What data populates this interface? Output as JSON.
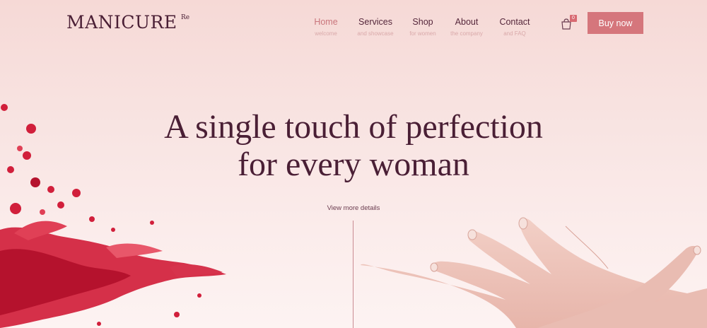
{
  "brand": {
    "name": "MANICURE",
    "superscript": "Re"
  },
  "nav": [
    {
      "label": "Home",
      "sub": "welcome"
    },
    {
      "label": "Services",
      "sub": "and showcase"
    },
    {
      "label": "Shop",
      "sub": "for women"
    },
    {
      "label": "About",
      "sub": "the company"
    },
    {
      "label": "Contact",
      "sub": "and FAQ"
    }
  ],
  "nav_active": "Home",
  "cart": {
    "icon": "shopping-bag-icon",
    "count": "0"
  },
  "buy_button": "Buy now",
  "hero": {
    "line1": "A single touch of perfection",
    "line2": "for every woman",
    "link": "View more details"
  },
  "colors": {
    "accent": "#d5767c",
    "text_dark": "#4a1f35",
    "background": "#f8e3e1",
    "splash": "#d11f3b"
  }
}
